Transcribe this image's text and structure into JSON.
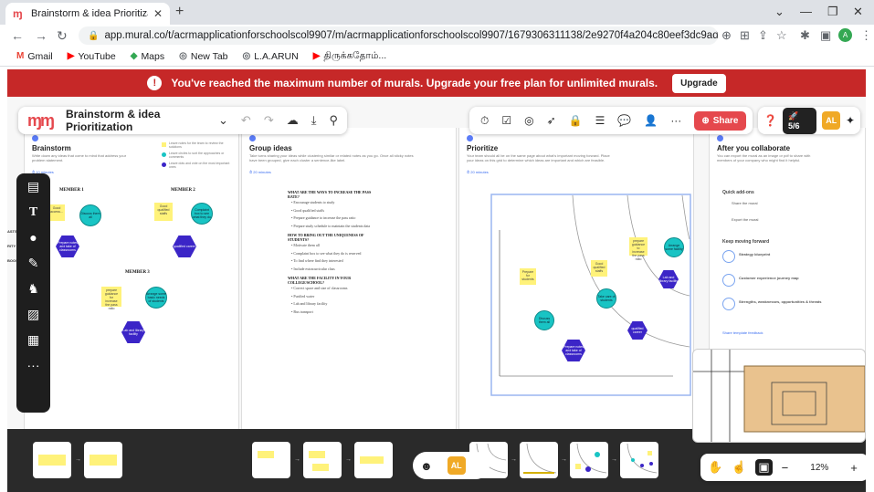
{
  "browser": {
    "tab_title": "Brainstorm & idea Prioritization -",
    "tab_close": "✕",
    "new_tab": "+",
    "url": "app.mural.co/t/acrmapplicationforschoolscol9907/m/acrmapplicationforschoolscol9907/1679306311138/2e9270f4a204c80eef3dc9ada699212e85f203d7...",
    "bookmarks": [
      {
        "label": "Gmail",
        "icon": "M",
        "color": "#ea4335"
      },
      {
        "label": "YouTube",
        "icon": "▶",
        "color": "#ff0000"
      },
      {
        "label": "Maps",
        "icon": "◆",
        "color": "#34a853"
      },
      {
        "label": "New Tab",
        "icon": "◎",
        "color": "#5f6368"
      },
      {
        "label": "L.A.ARUN",
        "icon": "◎",
        "color": "#5f6368"
      },
      {
        "label": "திருக்கதோம்...",
        "icon": "▶",
        "color": "#ff0000"
      }
    ],
    "profile_initials": "A"
  },
  "banner": {
    "message": "You've reached the maximum number of murals. Upgrade your free plan for unlimited murals.",
    "upgrade_label": "Upgrade"
  },
  "toolbar": {
    "mural_title": "Brainstorm & idea Prioritization",
    "share_label": "Share",
    "timer_label": "5/6",
    "avatar_initials": "AL",
    "colors": {
      "accent": "#e5484d",
      "banner": "#c62828",
      "dark": "#1e1e1e"
    }
  },
  "frames": {
    "brainstorm": {
      "title": "Brainstorm",
      "desc": "Write down any ideas that come to mind that address your problem statement.",
      "link": "⏱ 10 minutes",
      "legend": [
        "Leave notes for the team to review the solutions",
        "Leave circles to sort the approaches or comments",
        "Leave dots and vote on the most important ones"
      ],
      "members": [
        "MEMBER 1",
        "MEMBER 2",
        "MEMBER 3"
      ],
      "items": {
        "sticky1": "Good access...",
        "circle1": "Discuss them all",
        "hex1": "Prepare notes and take of classrooms",
        "sticky2": "Good qualified staffs",
        "circle2": "Complaint box to see what they do",
        "hex2": "qualified career",
        "sticky3": "prepare guidance for increase the pass ratio",
        "circle3": "Arrange some basic needs of students",
        "hex3": "Lab and library facility"
      }
    },
    "group": {
      "title": "Group ideas",
      "desc": "Take turns sharing your ideas while clustering similar or related notes as you go. Once all sticky notes have been grouped, give each cluster a sentence-like label.",
      "link": "⏱ 20 minutes",
      "lines": [
        {
          "text": "WHAT ARE THE WAYS TO INCREASE THE PASS RATE?",
          "h": true
        },
        {
          "text": "• Encourage students to study",
          "h": false
        },
        {
          "text": "• Good qualified staffs",
          "h": false
        },
        {
          "text": "• Prepare guidance to increase the pass ratio",
          "h": false
        },
        {
          "text": "• Prepare study schedule to maintain the students data",
          "h": false
        },
        {
          "text": "HOW TO BRING OUT THE UNIQUENESS OF STUDENTS?",
          "h": true
        },
        {
          "text": "• Motivate them all",
          "h": false
        },
        {
          "text": "• Complaint box to see what they do is reserved",
          "h": false
        },
        {
          "text": "• To find where find they interested",
          "h": false
        },
        {
          "text": "• Include extracurricular class",
          "h": false
        },
        {
          "text": "WHAT ARE THE FACILITY IN YOUR COLLEGE/SCHOOL?",
          "h": true
        },
        {
          "text": "• Correct space and size of classrooms",
          "h": false
        },
        {
          "text": "• Purified water",
          "h": false
        },
        {
          "text": "• Lab and library facility",
          "h": false
        },
        {
          "text": "• Bus transport",
          "h": false
        }
      ]
    },
    "prioritize": {
      "title": "Prioritize",
      "desc": "Your team should all be on the same page about what's important moving forward. Place your ideas on this grid to determine which ideas are important and which are feasible.",
      "link": "⏱ 20 minutes",
      "items": {
        "sticky1": "Prepare for students",
        "sticky2": "Good qualified staffs",
        "sticky3": "prepare guidance to increase the pass ratio",
        "circle1": "Discuss them all",
        "circle2": "Take care of students",
        "circle3": "Arrange some facility",
        "hex1": "Lab and library facility",
        "hex2": "Prepare notes and take of classrooms",
        "hex3": "qualified career"
      }
    },
    "after": {
      "title": "After you collaborate",
      "desc": "You can export the mural as an image or pdf to share with members of your company who might find it helpful.",
      "quick_head": "Quick add-ons",
      "quick_items": [
        "Share the mural",
        "Export the mural"
      ],
      "keep_head": "Keep moving forward",
      "keep_items": [
        "Strategy blueprint",
        "Customer experience journey map",
        "Strengths, weaknesses, opportunities & threats"
      ],
      "footer_link": "Share template feedback"
    }
  },
  "left_cut": [
    "ASTS",
    "RITY",
    "BOOS"
  ],
  "zoom": {
    "value": "12%",
    "minus": "−",
    "plus": "+"
  },
  "presence": {
    "avatar": "AL"
  }
}
